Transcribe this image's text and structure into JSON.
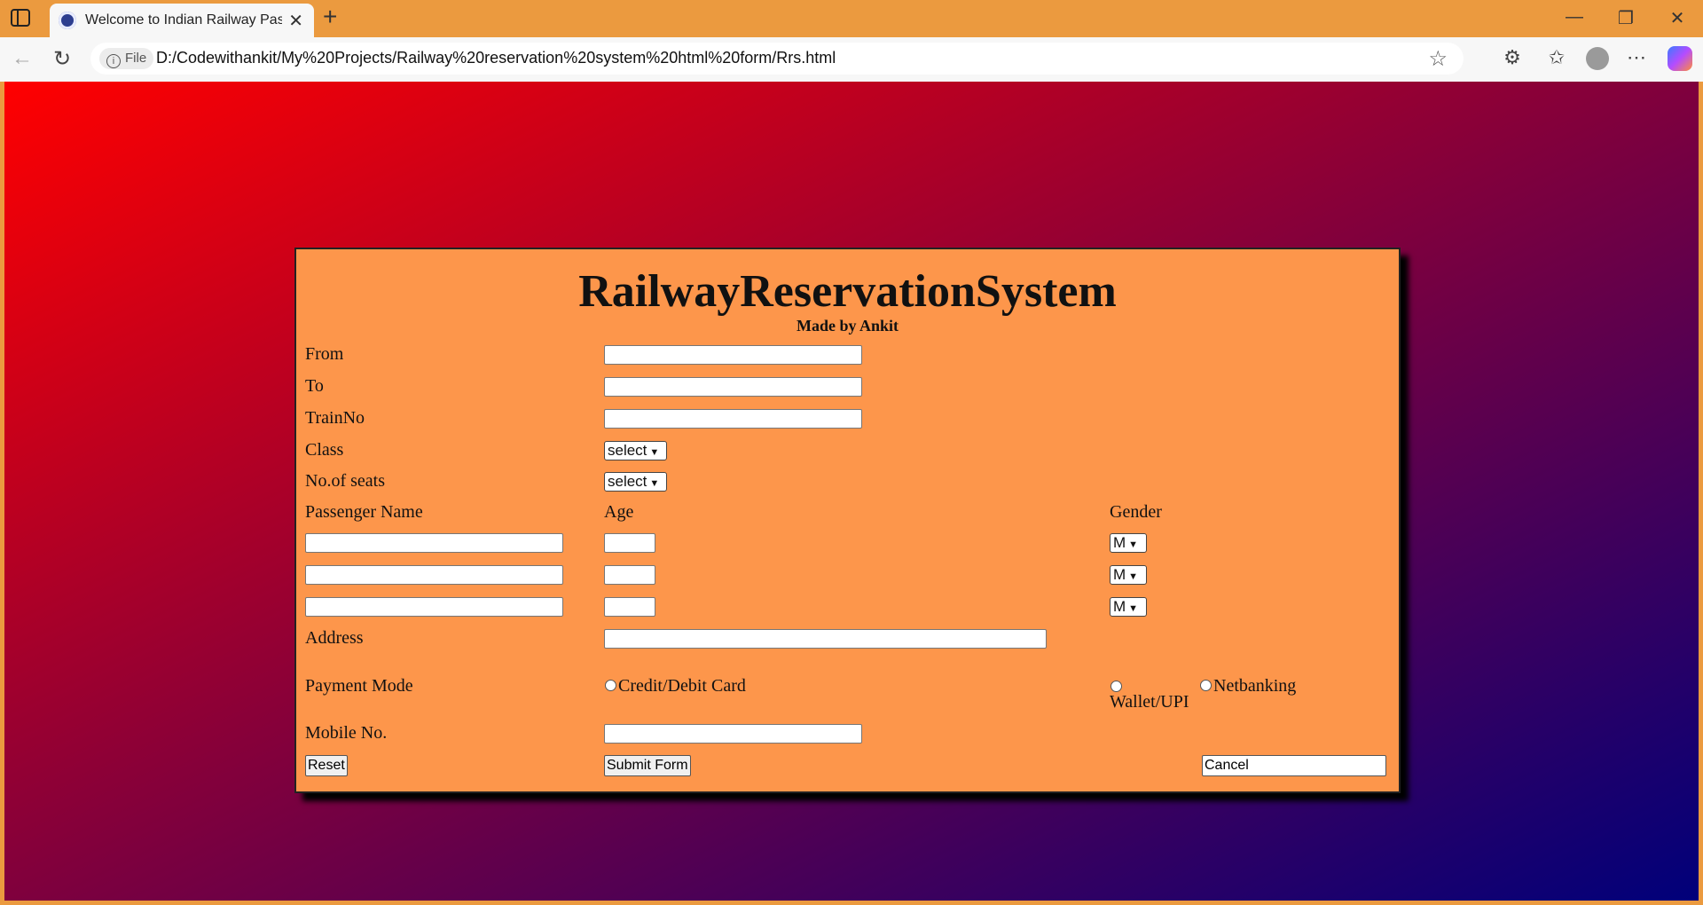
{
  "browser": {
    "tab_title": "Welcome to Indian Railway Passer",
    "file_chip": "File",
    "url": "D:/Codewithankit/My%20Projects/Railway%20reservation%20system%20html%20form/Rrs.html",
    "icons": [
      "sidebar-icon",
      "back-icon",
      "reload-icon",
      "star-icon",
      "extensions-icon",
      "favorites-icon",
      "profile-icon",
      "more-icon",
      "copilot-icon",
      "minimize-icon",
      "restore-icon",
      "close-icon"
    ]
  },
  "form": {
    "heading": "RailwayReservationSystem",
    "subheading": "Made by Ankit",
    "labels": {
      "from": "From",
      "to": "To",
      "train_no": "TrainNo",
      "class": "Class",
      "seats": "No.of seats",
      "passenger_name": "Passenger Name",
      "age": "Age",
      "gender": "Gender",
      "address": "Address",
      "payment_mode": "Payment Mode",
      "mobile": "Mobile No."
    },
    "class_select": "select",
    "seats_select": "select",
    "passengers": [
      {
        "gender": "M"
      },
      {
        "gender": "M"
      },
      {
        "gender": "M"
      }
    ],
    "payment_options": {
      "card": "Credit/Debit Card",
      "wallet": "Wallet/UPI",
      "netbanking": "Netbanking"
    },
    "buttons": {
      "reset": "Reset",
      "submit": "Submit Form",
      "cancel": "Cancel"
    }
  },
  "colors": {
    "form_bg": "#fd964b",
    "gradient_start": "#ff0000",
    "gradient_end": "#00007a",
    "chrome": "#eb9a3f"
  }
}
